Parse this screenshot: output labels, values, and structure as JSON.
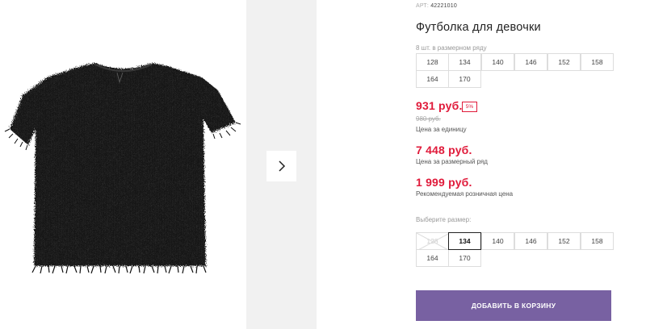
{
  "product": {
    "sku_label": "АРТ:",
    "sku_value": "42221010",
    "title": "Футболка для девочки"
  },
  "size_range": {
    "note": "8 шт. в размерном ряду",
    "sizes": [
      "128",
      "134",
      "140",
      "146",
      "152",
      "158",
      "164",
      "170"
    ]
  },
  "pricing": {
    "unit_price": "931 руб.",
    "discount_badge": "5%",
    "old_price": "980 руб.",
    "unit_note": "Цена за единицу",
    "range_price": "7 448 руб.",
    "range_note": "Цена за размерный ряд",
    "retail_price": "1 999 руб.",
    "retail_note": "Рекомендуемая розничная цена",
    "accent_color": "#e01a3a"
  },
  "size_select": {
    "label": "Выберите размер:",
    "options": [
      {
        "size": "128",
        "state": "unavailable"
      },
      {
        "size": "134",
        "state": "selected"
      },
      {
        "size": "140",
        "state": "available"
      },
      {
        "size": "146",
        "state": "available"
      },
      {
        "size": "152",
        "state": "available"
      },
      {
        "size": "158",
        "state": "available"
      },
      {
        "size": "164",
        "state": "available"
      },
      {
        "size": "170",
        "state": "available"
      }
    ]
  },
  "gallery": {
    "next_icon": "chevron-right-icon",
    "image_alt": "black fluffy t-shirt"
  },
  "cart": {
    "button_label": "ДОБАВИТЬ В КОРЗИНУ",
    "button_color": "#7861a2"
  }
}
